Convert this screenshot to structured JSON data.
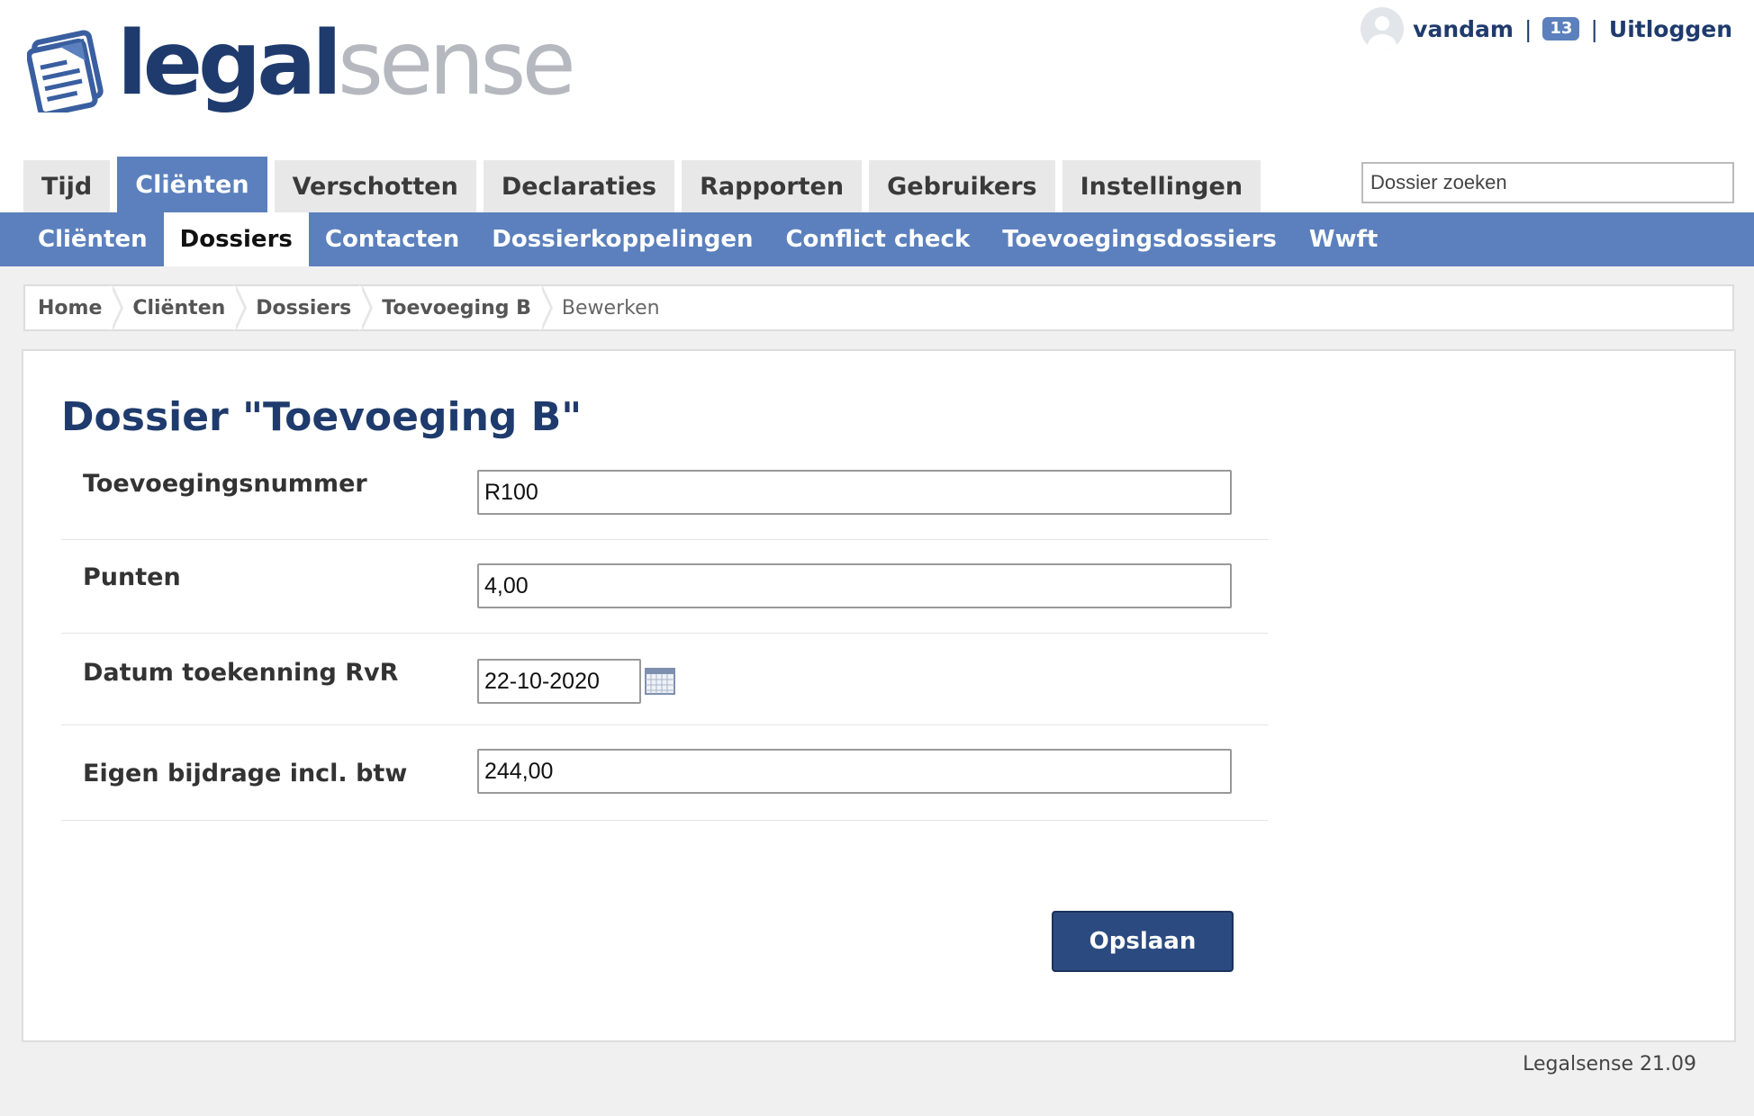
{
  "brand": {
    "part1": "legal",
    "part2": "sense"
  },
  "user": {
    "name": "vandam",
    "separator": "|",
    "notification_count": "13",
    "logout_label": "Uitloggen"
  },
  "main_tabs": [
    {
      "label": "Tijd"
    },
    {
      "label": "Cliënten",
      "active": true
    },
    {
      "label": "Verschotten"
    },
    {
      "label": "Declaraties"
    },
    {
      "label": "Rapporten"
    },
    {
      "label": "Gebruikers"
    },
    {
      "label": "Instellingen"
    }
  ],
  "search": {
    "placeholder": "Dossier zoeken"
  },
  "sub_tabs": [
    {
      "label": "Cliënten"
    },
    {
      "label": "Dossiers",
      "active": true
    },
    {
      "label": "Contacten"
    },
    {
      "label": "Dossierkoppelingen"
    },
    {
      "label": "Conflict check"
    },
    {
      "label": "Toevoegingsdossiers"
    },
    {
      "label": "Wwft"
    }
  ],
  "breadcrumb": [
    {
      "label": "Home"
    },
    {
      "label": "Cliënten"
    },
    {
      "label": "Dossiers"
    },
    {
      "label": "Toevoeging B"
    },
    {
      "label": "Bewerken"
    }
  ],
  "page_title": "Dossier \"Toevoeging B\"",
  "form": {
    "fields": [
      {
        "label": "Toevoegingsnummer",
        "value": "R100"
      },
      {
        "label": "Punten",
        "value": "4,00"
      },
      {
        "label": "Datum toekenning RvR",
        "value": "22-10-2020"
      },
      {
        "label": "Eigen bijdrage incl. btw",
        "value": "244,00"
      }
    ],
    "save_label": "Opslaan"
  },
  "footer": {
    "version": "Legalsense 21.09"
  },
  "colors": {
    "accent": "#5b80bd",
    "brand_dark": "#1f3b6d",
    "button": "#2b4a80"
  }
}
